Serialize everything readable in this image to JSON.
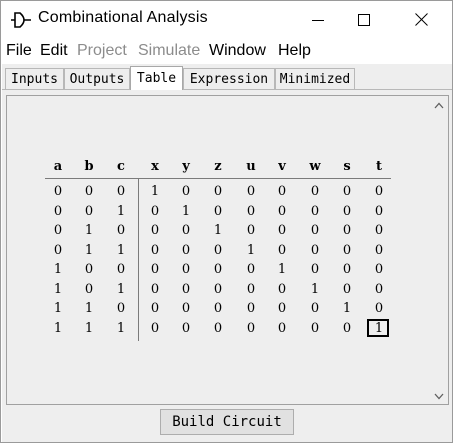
{
  "window": {
    "title": "Combinational Analysis",
    "icon": "circuit-gate-icon",
    "controls": [
      "minimize-icon",
      "maximize-icon",
      "close-icon"
    ]
  },
  "menu": [
    {
      "label": "File",
      "enabled": true
    },
    {
      "label": "Edit",
      "enabled": true
    },
    {
      "label": "Project",
      "enabled": false
    },
    {
      "label": "Simulate",
      "enabled": false
    },
    {
      "label": "Window",
      "enabled": true
    },
    {
      "label": "Help",
      "enabled": true
    }
  ],
  "tabs": [
    {
      "label": "Inputs",
      "selected": false
    },
    {
      "label": "Outputs",
      "selected": false
    },
    {
      "label": "Table",
      "selected": true
    },
    {
      "label": "Expression",
      "selected": false
    },
    {
      "label": "Minimized",
      "selected": false
    }
  ],
  "truth_table": {
    "inputs": [
      "a",
      "b",
      "c"
    ],
    "outputs": [
      "x",
      "y",
      "z",
      "u",
      "v",
      "w",
      "s",
      "t"
    ],
    "rows": [
      {
        "in": [
          "0",
          "0",
          "0"
        ],
        "out": [
          "1",
          "0",
          "0",
          "0",
          "0",
          "0",
          "0",
          "0"
        ]
      },
      {
        "in": [
          "0",
          "0",
          "1"
        ],
        "out": [
          "0",
          "1",
          "0",
          "0",
          "0",
          "0",
          "0",
          "0"
        ]
      },
      {
        "in": [
          "0",
          "1",
          "0"
        ],
        "out": [
          "0",
          "0",
          "1",
          "0",
          "0",
          "0",
          "0",
          "0"
        ]
      },
      {
        "in": [
          "0",
          "1",
          "1"
        ],
        "out": [
          "0",
          "0",
          "0",
          "1",
          "0",
          "0",
          "0",
          "0"
        ]
      },
      {
        "in": [
          "1",
          "0",
          "0"
        ],
        "out": [
          "0",
          "0",
          "0",
          "0",
          "1",
          "0",
          "0",
          "0"
        ]
      },
      {
        "in": [
          "1",
          "0",
          "1"
        ],
        "out": [
          "0",
          "0",
          "0",
          "0",
          "0",
          "1",
          "0",
          "0"
        ]
      },
      {
        "in": [
          "1",
          "1",
          "0"
        ],
        "out": [
          "0",
          "0",
          "0",
          "0",
          "0",
          "0",
          "1",
          "0"
        ]
      },
      {
        "in": [
          "1",
          "1",
          "1"
        ],
        "out": [
          "0",
          "0",
          "0",
          "0",
          "0",
          "0",
          "0",
          "1"
        ]
      }
    ],
    "selected_cell": {
      "row": 7,
      "column": "t"
    }
  },
  "build_button": {
    "label": "Build Circuit"
  },
  "colors": {
    "panel_bg": "#eeeeee",
    "disabled_text": "#8c8c8c",
    "button_bg": "#e1e1e1"
  }
}
